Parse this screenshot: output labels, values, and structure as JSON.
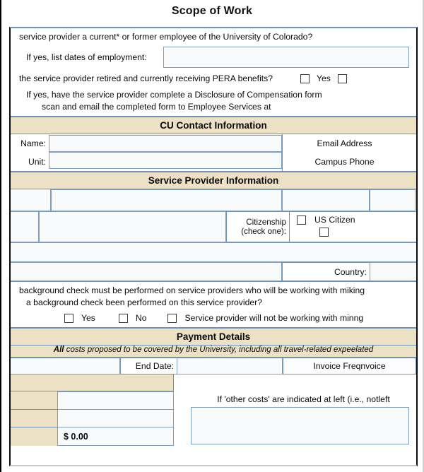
{
  "document": {
    "title": "Scope of Work"
  },
  "employment_section": {
    "question": "service provider a current* or former employee of the University of Colorado?",
    "dates_label": "If yes, list dates of employment:",
    "dates_value": "",
    "pera_question": "the service provider retired and currently receiving PERA benefits?",
    "pera_yes_label": "Yes",
    "pera_checkbox_1_checked": false,
    "pera_checkbox_2_checked": false,
    "followup_line_1": "If yes, have the service provider complete a Disclosure of Compensation form",
    "followup_line_2": "scan and email the completed form to Employee Services at"
  },
  "cu_contact": {
    "heading": "CU Contact Information",
    "name_label": "Name:",
    "name_value": "",
    "unit_label": "Unit:",
    "unit_value": "",
    "email_label": "Email Address",
    "email_value": "",
    "phone_label": "Campus Phone",
    "phone_value": ""
  },
  "service_provider": {
    "heading": "Service Provider Information",
    "row1": {
      "cell1": "",
      "cell2": "",
      "cell3": "",
      "cell4": ""
    },
    "row2": {
      "cell1": "",
      "cell2": "",
      "citizenship_label_line1": "Citizenship",
      "citizenship_label_line2": "(check one):",
      "us_citizen_label": "US Citizen",
      "us_citizen_checked": false,
      "other_citizen_checked": false
    },
    "row3": {
      "value": ""
    },
    "row4": {
      "value": "",
      "country_label": "Country:",
      "country_value": ""
    }
  },
  "background_check": {
    "line1": "background check must be performed on service providers who will be working with miking",
    "line2": "a background check been performed on this service provider?",
    "yes_label": "Yes",
    "yes_checked": false,
    "no_label": "No",
    "no_checked": false,
    "na_label": "Service provider will not be working with minng",
    "na_checked": false
  },
  "payment_details": {
    "heading": "Payment Details",
    "note_emphasis": "All",
    "note_rest": "costs proposed to be covered by the University, including all travel-related expeelated",
    "start_date_value": "",
    "end_date_label": "End Date:",
    "end_date_value": "",
    "invoice_frequency_label": "Invoice Freqnvoice",
    "cost_rows": [
      {
        "label": "",
        "value": ""
      },
      {
        "label": "",
        "value": ""
      },
      {
        "label": "",
        "value": "$ 0.00"
      }
    ],
    "other_costs_note": "If 'other costs' are indicated at left (i.e., notleft",
    "other_costs_value": ""
  },
  "colors": {
    "band": "#ECE0C5",
    "field_border": "#7B9EC4",
    "field_fill": "#F8FAFC",
    "frame_border": "#0A0A0A",
    "rule": "#6F93B8"
  }
}
